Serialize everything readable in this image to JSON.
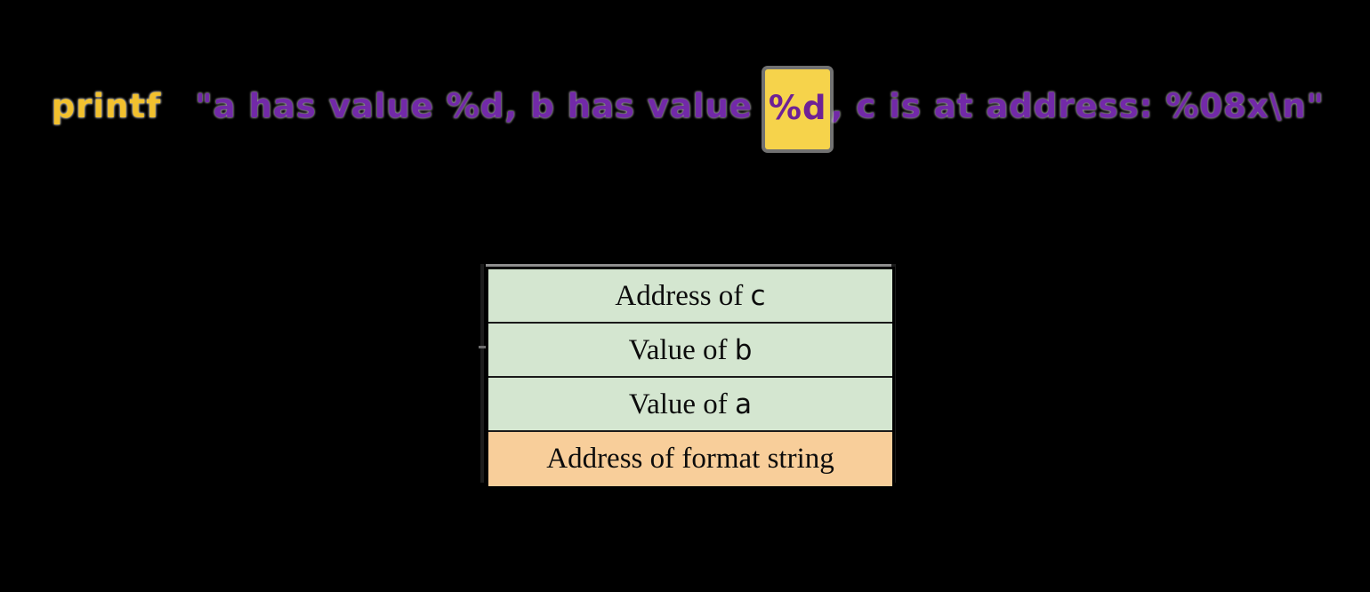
{
  "background_color": "#000000",
  "code_line": {
    "function_name": "printf",
    "string_part_1": "\"a has value %d, b has value ",
    "highlight": "%d",
    "string_part_2": ", c is at address: %08x\\n\"",
    "ampersand": "&",
    "colors": {
      "function": "#F2C12E",
      "string": "#7229A8",
      "highlight_background": "#F6D34B",
      "highlight_text": "#6E2196",
      "ampersand": "#0B72C4"
    }
  },
  "stack_diagram": {
    "name": "stack-frame",
    "colors": {
      "green_cell": "#D4E6D0",
      "orange_cell": "#F8CE9A",
      "border": "#000000",
      "text": "#0C0C0C"
    },
    "rows": [
      {
        "prefix": "Address of ",
        "variable": "c",
        "suffix": "",
        "fill": "green"
      },
      {
        "prefix": "Value of ",
        "variable": "b",
        "suffix": "",
        "fill": "green"
      },
      {
        "prefix": "Value of ",
        "variable": "a",
        "suffix": "",
        "fill": "green"
      },
      {
        "prefix": "Address of format string",
        "variable": "",
        "suffix": "",
        "fill": "orange"
      }
    ]
  }
}
